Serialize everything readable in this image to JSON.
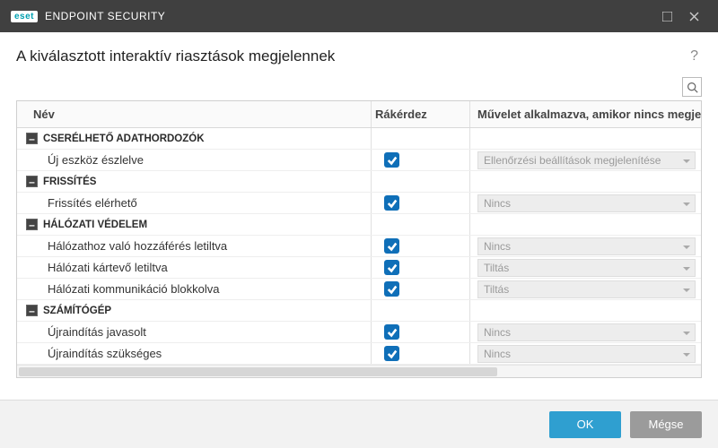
{
  "titlebar": {
    "brand": "eset",
    "product": "ENDPOINT SECURITY"
  },
  "heading": "A kiválasztott interaktív riasztások megjelennek",
  "help_symbol": "?",
  "columns": {
    "name": "Név",
    "ask": "Rákérdez",
    "action": "Művelet alkalmazva, amikor nincs megjelení"
  },
  "groups": [
    {
      "name": "CSERÉLHETŐ ADATHORDOZÓK",
      "items": [
        {
          "label": "Új eszköz észlelve",
          "ask": true,
          "action": "Ellenőrzési beállítások megjelenítése"
        }
      ]
    },
    {
      "name": "FRISSÍTÉS",
      "items": [
        {
          "label": "Frissítés elérhető",
          "ask": true,
          "action": "Nincs"
        }
      ]
    },
    {
      "name": "HÁLÓZATI VÉDELEM",
      "items": [
        {
          "label": "Hálózathoz való hozzáférés letiltva",
          "ask": true,
          "action": "Nincs"
        },
        {
          "label": "Hálózati kártevő letiltva",
          "ask": true,
          "action": "Tiltás"
        },
        {
          "label": "Hálózati kommunikáció blokkolva",
          "ask": true,
          "action": "Tiltás"
        }
      ]
    },
    {
      "name": "SZÁMÍTÓGÉP",
      "items": [
        {
          "label": "Újraindítás javasolt",
          "ask": true,
          "action": "Nincs"
        },
        {
          "label": "Újraindítás szükséges",
          "ask": true,
          "action": "Nincs"
        }
      ]
    }
  ],
  "footer": {
    "ok": "OK",
    "cancel": "Mégse"
  },
  "expander_glyph": "–"
}
